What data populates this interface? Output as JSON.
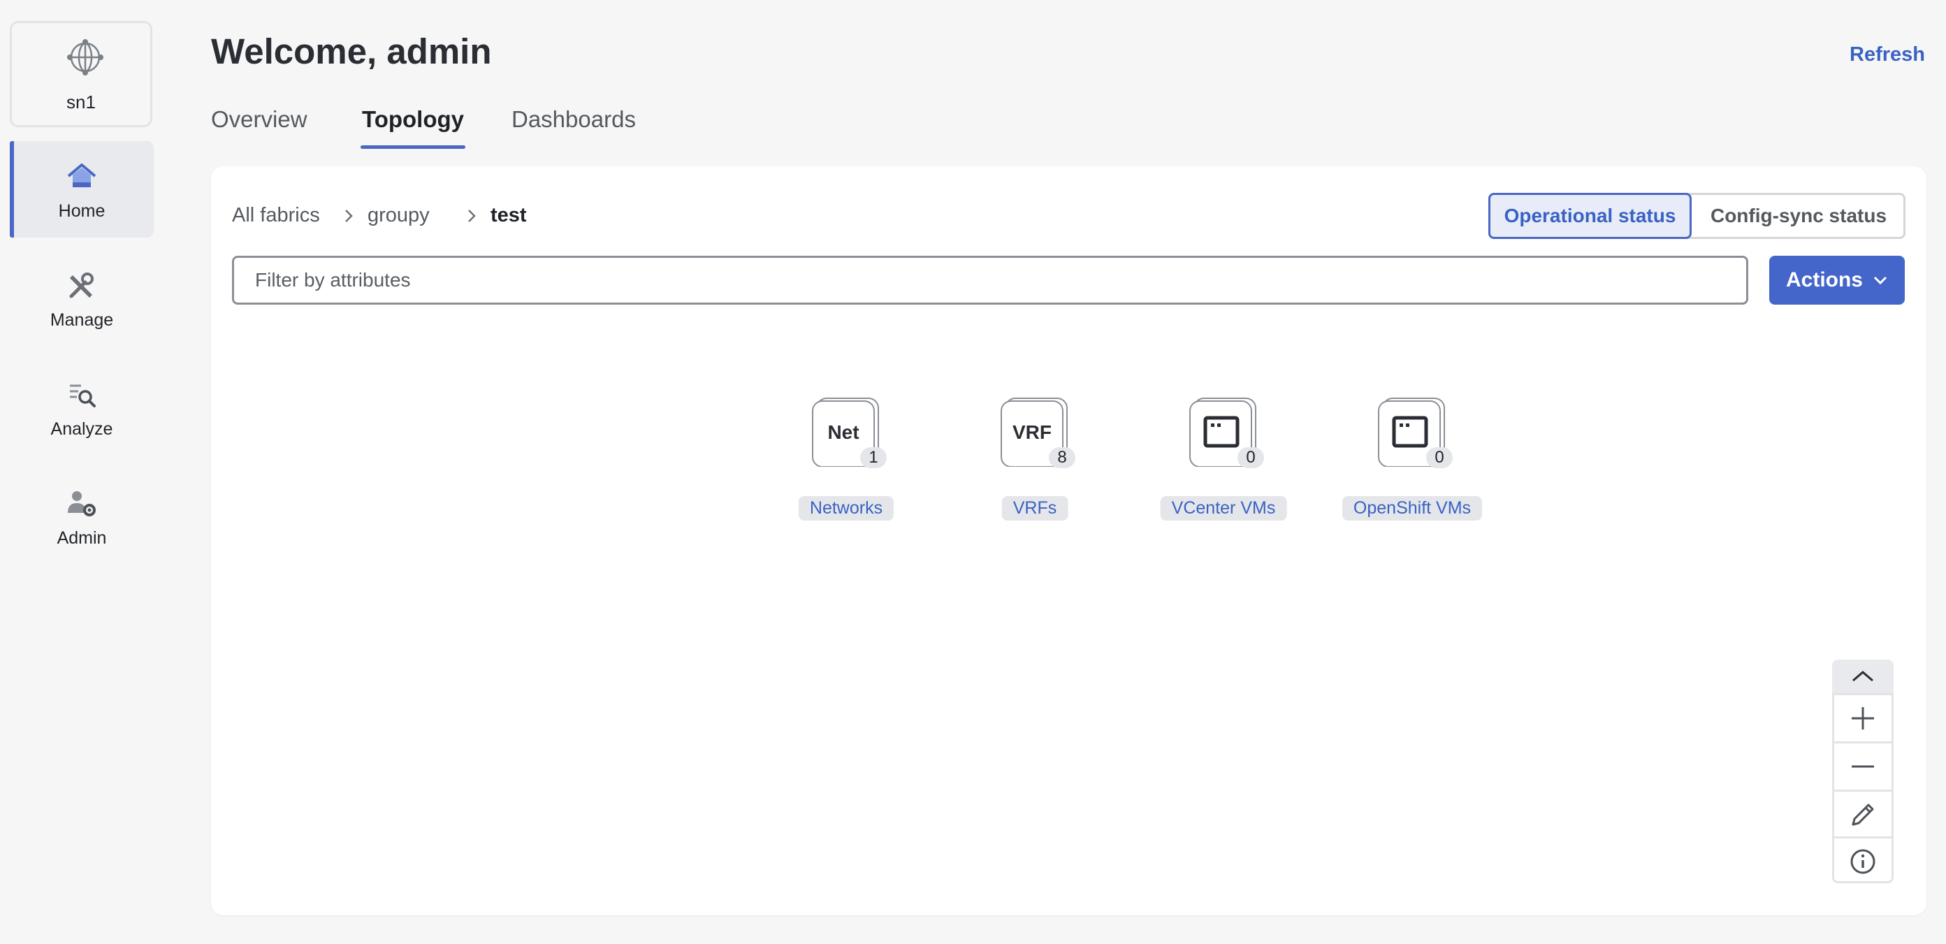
{
  "sidebar": {
    "site_name": "sn1",
    "items": [
      {
        "label": "Home",
        "icon": "home-icon",
        "active": true
      },
      {
        "label": "Manage",
        "icon": "wrench-screwdriver-icon",
        "active": false
      },
      {
        "label": "Analyze",
        "icon": "analyze-icon",
        "active": false
      },
      {
        "label": "Admin",
        "icon": "user-gear-icon",
        "active": false
      }
    ]
  },
  "header": {
    "title": "Welcome, admin",
    "refresh_label": "Refresh"
  },
  "tabs": [
    {
      "label": "Overview",
      "active": false
    },
    {
      "label": "Topology",
      "active": true
    },
    {
      "label": "Dashboards",
      "active": false
    }
  ],
  "breadcrumb": {
    "items": [
      "All fabrics",
      "groupy",
      "test"
    ]
  },
  "status_toggle": {
    "operational": "Operational status",
    "config_sync": "Config-sync status",
    "selected": "Operational status"
  },
  "filter": {
    "placeholder": "Filter by attributes",
    "value": ""
  },
  "actions_label": "Actions",
  "topology": {
    "nodes": [
      {
        "icon_text": "Net",
        "count": "1",
        "label": "Networks",
        "icon": "network-icon"
      },
      {
        "icon_text": "VRF",
        "count": "8",
        "label": "VRFs",
        "icon": "vrf-icon"
      },
      {
        "icon_text": "",
        "count": "0",
        "label": "VCenter VMs",
        "icon": "vm-window-icon"
      },
      {
        "icon_text": "",
        "count": "0",
        "label": "OpenShift VMs",
        "icon": "vm-window-icon"
      }
    ]
  },
  "colors": {
    "accent": "#4a67c5",
    "link": "#3a62c4",
    "background": "#f6f6f6"
  }
}
